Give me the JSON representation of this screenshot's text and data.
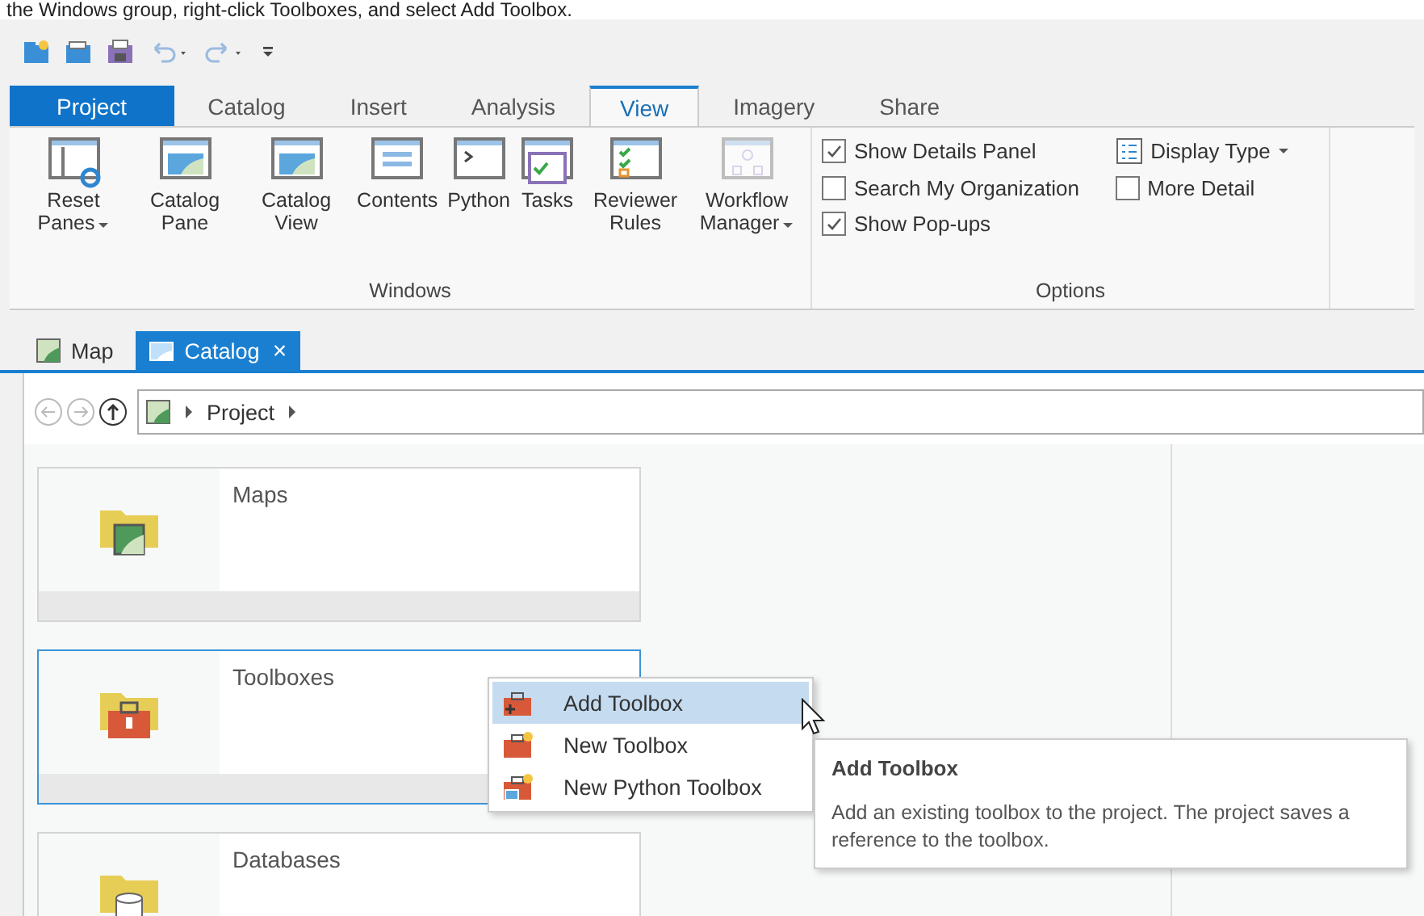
{
  "caption": "the Windows group, right-click Toolboxes, and select Add Toolbox.",
  "tabs": [
    {
      "label": "Project",
      "kind": "file",
      "selected": false
    },
    {
      "label": "Catalog",
      "kind": "tab",
      "selected": false
    },
    {
      "label": "Insert",
      "kind": "tab",
      "selected": false
    },
    {
      "label": "Analysis",
      "kind": "tab",
      "selected": false
    },
    {
      "label": "View",
      "kind": "tab",
      "selected": true
    },
    {
      "label": "Imagery",
      "kind": "tab",
      "selected": false
    },
    {
      "label": "Share",
      "kind": "tab",
      "selected": false
    }
  ],
  "windows_group": {
    "label": "Windows",
    "buttons": [
      {
        "label": "Reset Panes",
        "dropdown": true,
        "disabled": false
      },
      {
        "label": "Catalog Pane",
        "dropdown": false,
        "disabled": false
      },
      {
        "label": "Catalog View",
        "dropdown": false,
        "disabled": false
      },
      {
        "label": "Contents",
        "dropdown": false,
        "disabled": false
      },
      {
        "label": "Python",
        "dropdown": false,
        "disabled": false
      },
      {
        "label": "Tasks",
        "dropdown": false,
        "disabled": false
      },
      {
        "label": "Reviewer Rules",
        "dropdown": false,
        "disabled": false
      },
      {
        "label": "Workflow Manager",
        "dropdown": true,
        "disabled": true
      }
    ]
  },
  "options_group": {
    "label": "Options",
    "items": [
      {
        "kind": "checkbox",
        "label": "Show Details Panel",
        "checked": true
      },
      {
        "kind": "dropdown",
        "label": "Display Type"
      },
      {
        "kind": "checkbox",
        "label": "Search My Organization",
        "checked": false
      },
      {
        "kind": "checkbox",
        "label": "More Detail",
        "checked": false
      },
      {
        "kind": "checkbox",
        "label": "Show Pop-ups",
        "checked": true
      }
    ]
  },
  "doc_tabs": [
    {
      "label": "Map",
      "selected": false
    },
    {
      "label": "Catalog",
      "selected": true,
      "close": "×"
    }
  ],
  "breadcrumb": [
    "Project"
  ],
  "cards": [
    {
      "title": "Maps",
      "kind": "map",
      "selected": false
    },
    {
      "title": "Toolboxes",
      "kind": "toolbox",
      "selected": true
    },
    {
      "title": "Databases",
      "kind": "database",
      "selected": false
    }
  ],
  "context_menu": [
    {
      "label": "Add Toolbox",
      "selected": true
    },
    {
      "label": "New Toolbox",
      "selected": false
    },
    {
      "label": "New Python Toolbox",
      "selected": false
    }
  ],
  "tooltip": {
    "title": "Add Toolbox",
    "text": "Add an existing toolbox to the project. The project saves a reference to the toolbox."
  }
}
